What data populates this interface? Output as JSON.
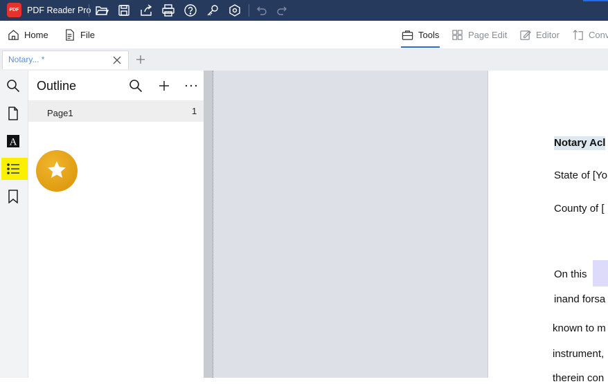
{
  "app": {
    "title": "PDF Reader Pro",
    "logo_text": "PDF"
  },
  "titlebar_icons": [
    "open-folder-icon",
    "save-icon",
    "share-icon",
    "print-icon",
    "help-icon",
    "key-icon",
    "settings-icon",
    "undo-icon",
    "redo-icon"
  ],
  "ribbon": {
    "home": "Home",
    "file": "File",
    "tools": "Tools",
    "page_edit": "Page Edit",
    "editor": "Editor",
    "convert": "Conv"
  },
  "tabs": {
    "active_label": "Notary... *"
  },
  "sidebar_icons": [
    "search-icon",
    "page-thumbnails-icon",
    "text-icon",
    "outline-list-icon",
    "bookmark-icon"
  ],
  "outline": {
    "title": "Outline",
    "items": [
      {
        "label": "Page1",
        "page": "1"
      }
    ]
  },
  "document": {
    "heading": "Notary Acl",
    "lines": [
      "State of [Yo",
      "County of [",
      "On this",
      "inand forsa",
      "known to m",
      "instrument,",
      "therein con"
    ]
  },
  "colors": {
    "titlebar": "#263a5e",
    "active_highlight": "#fbf000",
    "fab": "#e5a315",
    "tab_text": "#5a8fd8"
  }
}
